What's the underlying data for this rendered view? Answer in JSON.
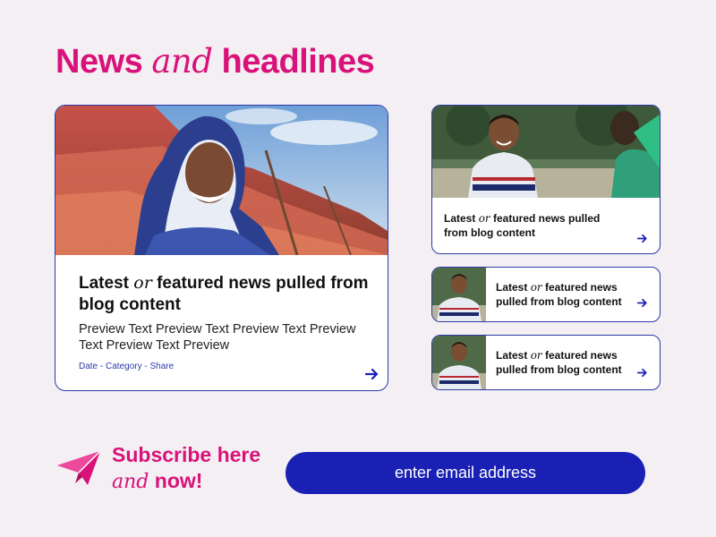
{
  "header": {
    "title_part1": "News",
    "title_part2": "and",
    "title_part3": "headlines"
  },
  "featured": {
    "title_part1": "Latest",
    "title_part2": "or",
    "title_part3": "featured news pulled from blog content",
    "preview": "Preview Text Preview Text Preview Text Preview Text Preview Text Preview",
    "meta": "Date - Category - Share",
    "image": "woman-in-hijab-smiling-photo"
  },
  "side_cards": [
    {
      "title_part1": "Latest",
      "title_part2": "or",
      "title_part3": "featured news pulled from blog content",
      "image": "boy-smiling-photo-wide"
    },
    {
      "title_part1": "Latest",
      "title_part2": "or",
      "title_part3": "featured news pulled from blog content",
      "image": "boy-smiling-photo-thumb"
    },
    {
      "title_part1": "Latest",
      "title_part2": "or",
      "title_part3": "featured news pulled from blog content",
      "image": "boy-smiling-photo-thumb"
    }
  ],
  "subscribe": {
    "line1": "Subscribe here",
    "line2_part1": "and",
    "line2_part2": "now!",
    "icon": "paper-plane-icon",
    "input_placeholder": "enter email address"
  },
  "colors": {
    "brand_pink": "#d8127a",
    "brand_blue": "#1a20b3",
    "border_blue": "#2b3aa8",
    "background": "#f4eff2"
  }
}
